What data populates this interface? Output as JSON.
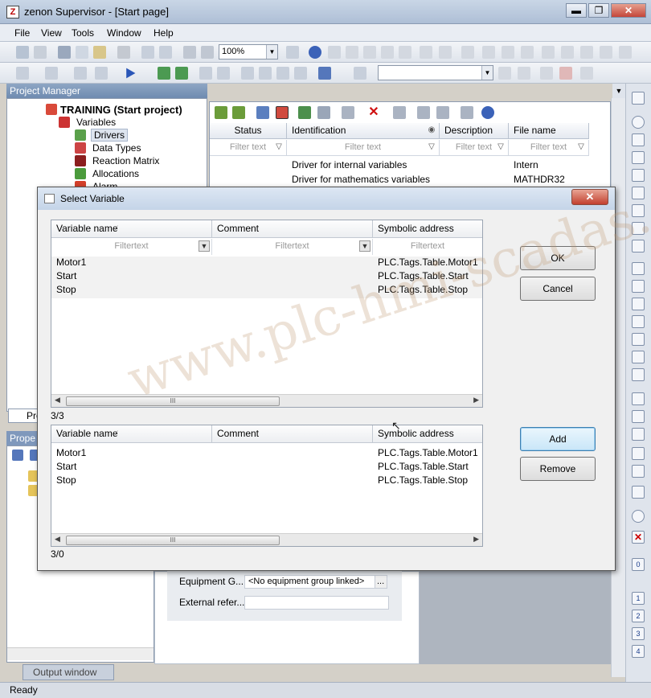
{
  "window": {
    "title": "zenon Supervisor - [Start page]",
    "icon_letter": "Z",
    "minimize": "▬",
    "maximize": "❐",
    "close": "✕"
  },
  "menu": [
    "File",
    "View",
    "Tools",
    "Window",
    "Help"
  ],
  "toolbar": {
    "zoom": "100%"
  },
  "project_manager": {
    "title": "Project Manager",
    "tree": [
      {
        "label": "TRAINING (Start project)",
        "bold": true
      },
      {
        "label": "Variables"
      },
      {
        "label": "Drivers",
        "selected": true
      },
      {
        "label": "Data Types"
      },
      {
        "label": "Reaction Matrix"
      },
      {
        "label": "Allocations"
      },
      {
        "label": "Alarm"
      }
    ],
    "tab": "Pro"
  },
  "properties_title": "Prope",
  "driver_grid": {
    "columns": [
      "Status",
      "Identification",
      "Description",
      "File name"
    ],
    "filter_placeholder": "Filter text",
    "rows": [
      {
        "identification": "Driver for internal variables",
        "file": "Intern"
      },
      {
        "identification": "Driver for mathematics variables",
        "file": "MATHDR32"
      }
    ]
  },
  "dialog": {
    "title": "Select Variable",
    "close": "✕",
    "columns": [
      "Variable name",
      "Comment",
      "Symbolic address"
    ],
    "filter_placeholder": "Filtertext",
    "available": [
      {
        "name": "Motor1",
        "address": "PLC.Tags.Table.Motor1"
      },
      {
        "name": "Start",
        "address": "PLC.Tags.Table.Start"
      },
      {
        "name": "Stop",
        "address": "PLC.Tags.Table.Stop"
      }
    ],
    "available_count": "3/3",
    "selected": [
      {
        "name": "Motor1",
        "address": "PLC.Tags.Table.Motor1"
      },
      {
        "name": "Start",
        "address": "PLC.Tags.Table.Start"
      },
      {
        "name": "Stop",
        "address": "PLC.Tags.Table.Stop"
      }
    ],
    "selected_count": "3/0",
    "ok": "OK",
    "cancel": "Cancel",
    "add": "Add",
    "remove": "Remove"
  },
  "properties": {
    "equipment_label": "Equipment G...",
    "equipment_value": "<No equipment group linked>",
    "browse": "...",
    "external_label": "External refer..."
  },
  "output_tab": "Output window",
  "status": "Ready",
  "watermark": "www.plc-hmi-scadas.com",
  "right_toolbar_labels": [
    "0",
    "1",
    "2",
    "3",
    "4"
  ]
}
